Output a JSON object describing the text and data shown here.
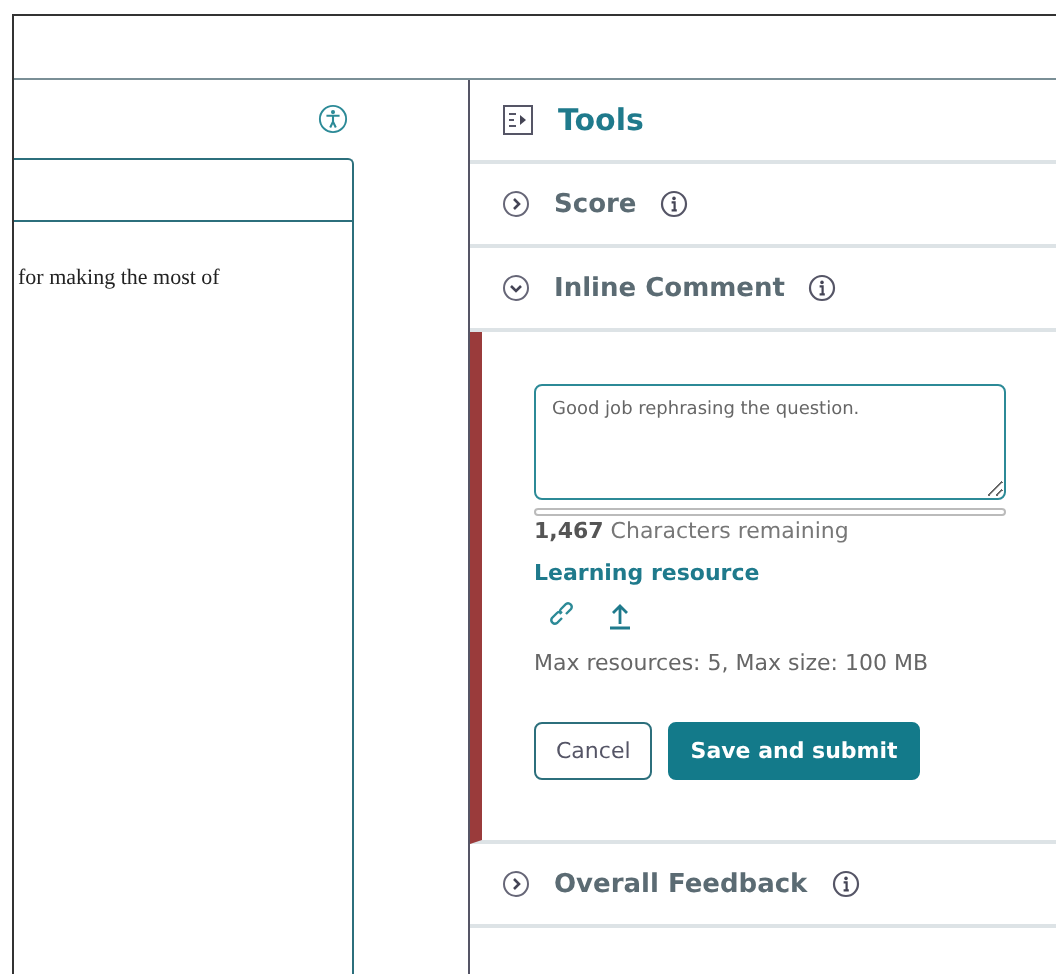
{
  "content_pane": {
    "text": "for making the most of"
  },
  "tools_panel": {
    "title": "Tools",
    "sections": [
      {
        "title": "Score",
        "expanded": false
      },
      {
        "title": "Inline Comment",
        "expanded": true,
        "comment": {
          "value": "Good job rephrasing the question.",
          "remaining": "**1,467** Characters remaining",
          "resource_heading": "Learning resource",
          "limits": "Max resources: 5, Max size: 100 MB",
          "buttons": [
            {
              "label": "Cancel",
              "kind": "secondary"
            },
            {
              "label": "Save and submit",
              "kind": "primary"
            }
          ]
        }
      },
      {
        "title": "Overall Feedback",
        "expanded": false
      }
    ]
  }
}
